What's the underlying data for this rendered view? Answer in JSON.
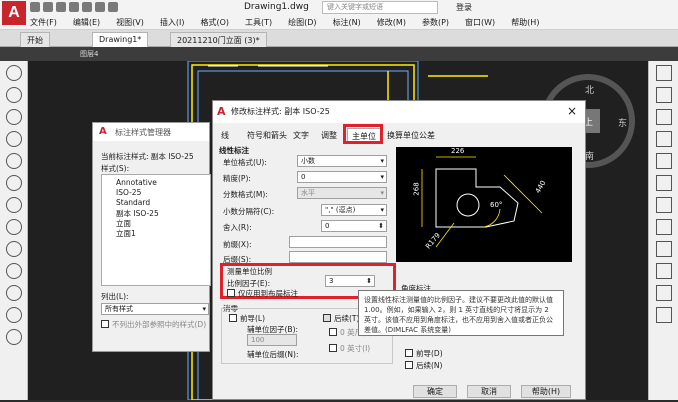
{
  "app": {
    "title": "Drawing1.dwg",
    "search_placeholder": "键入关键字或短语",
    "login": "登录",
    "logo": "A"
  },
  "menus": [
    "文件(F)",
    "编辑(E)",
    "视图(V)",
    "插入(I)",
    "格式(O)",
    "工具(T)",
    "绘图(D)",
    "标注(N)",
    "修改(M)",
    "参数(P)",
    "窗口(W)",
    "帮助(H)"
  ],
  "tabs": [
    "开始",
    "Drawing1*",
    "20211210门立面 (3)*"
  ],
  "layer_label": "图层4",
  "compass": {
    "north": "北",
    "east": "东",
    "south": "南",
    "top": "上"
  },
  "style_manager": {
    "title": "标注样式管理器",
    "current_style": "当前标注样式: 副本 ISO-25",
    "styles_label": "样式(S):",
    "styles": [
      "Annotative",
      "ISO-25",
      "Standard",
      "副本 ISO-25",
      "立面",
      "立面1"
    ],
    "list_label": "列出(L):",
    "list_value": "所有样式",
    "exclude_xref": "不列出外部参照中的样式(D)"
  },
  "modify_dialog": {
    "title": "修改标注样式: 副本 ISO-25",
    "close": "×",
    "tabs": [
      "线",
      "符号和箭头",
      "文字",
      "调整",
      "主单位",
      "换算单位",
      "公差"
    ],
    "linear_section": "线性标注",
    "unit_format_label": "单位格式(U):",
    "unit_format": "小数",
    "precision_label": "精度(P):",
    "precision": "0",
    "fraction_label": "分数格式(M):",
    "fraction": "水平",
    "decimal_sep_label": "小数分隔符(C):",
    "decimal_sep": "\",\" (逗点)",
    "round_label": "舍入(R):",
    "round": "0",
    "prefix_label": "前缀(X):",
    "suffix_label": "后缀(S):",
    "scale_section": "测量单位比例",
    "scale_factor_label": "比例因子(E):",
    "scale_factor": "3",
    "layout_only": "仅应用到布局标注",
    "zero_suppress": "消零",
    "leading": "前导(L)",
    "trailing": "后续(T)",
    "sub_unit_factor": "辅单位因子(B):",
    "sub_unit_value": "100",
    "feet": "0 英尺(F)",
    "inches": "0 英寸(I)",
    "sub_unit_suffix": "辅单位后缀(N):",
    "angular_section": "角度标注",
    "angular_leading": "前导(D)",
    "angular_trailing": "后续(N)",
    "ok": "确定",
    "cancel": "取消",
    "help": "帮助(H)"
  },
  "tooltip": "设置线性标注测量值的比例因子。建议不要更改此值的默认值 1.00。例如，如果输入 2，则 1 英寸直线的尺寸将显示为 2 英寸。该值不应用到角度标注，也不应用到舍入值或者正负公差值。(DIMLFAC 系统变量)",
  "preview": {
    "dim_top": "226",
    "dim_left": "268",
    "dim_right": "440",
    "dim_angle": "60°",
    "dim_radius": "R179"
  },
  "colors": {
    "accent_red": "#e0202a",
    "cad_bg": "#202020",
    "dim_yellow": "#ffee00"
  }
}
